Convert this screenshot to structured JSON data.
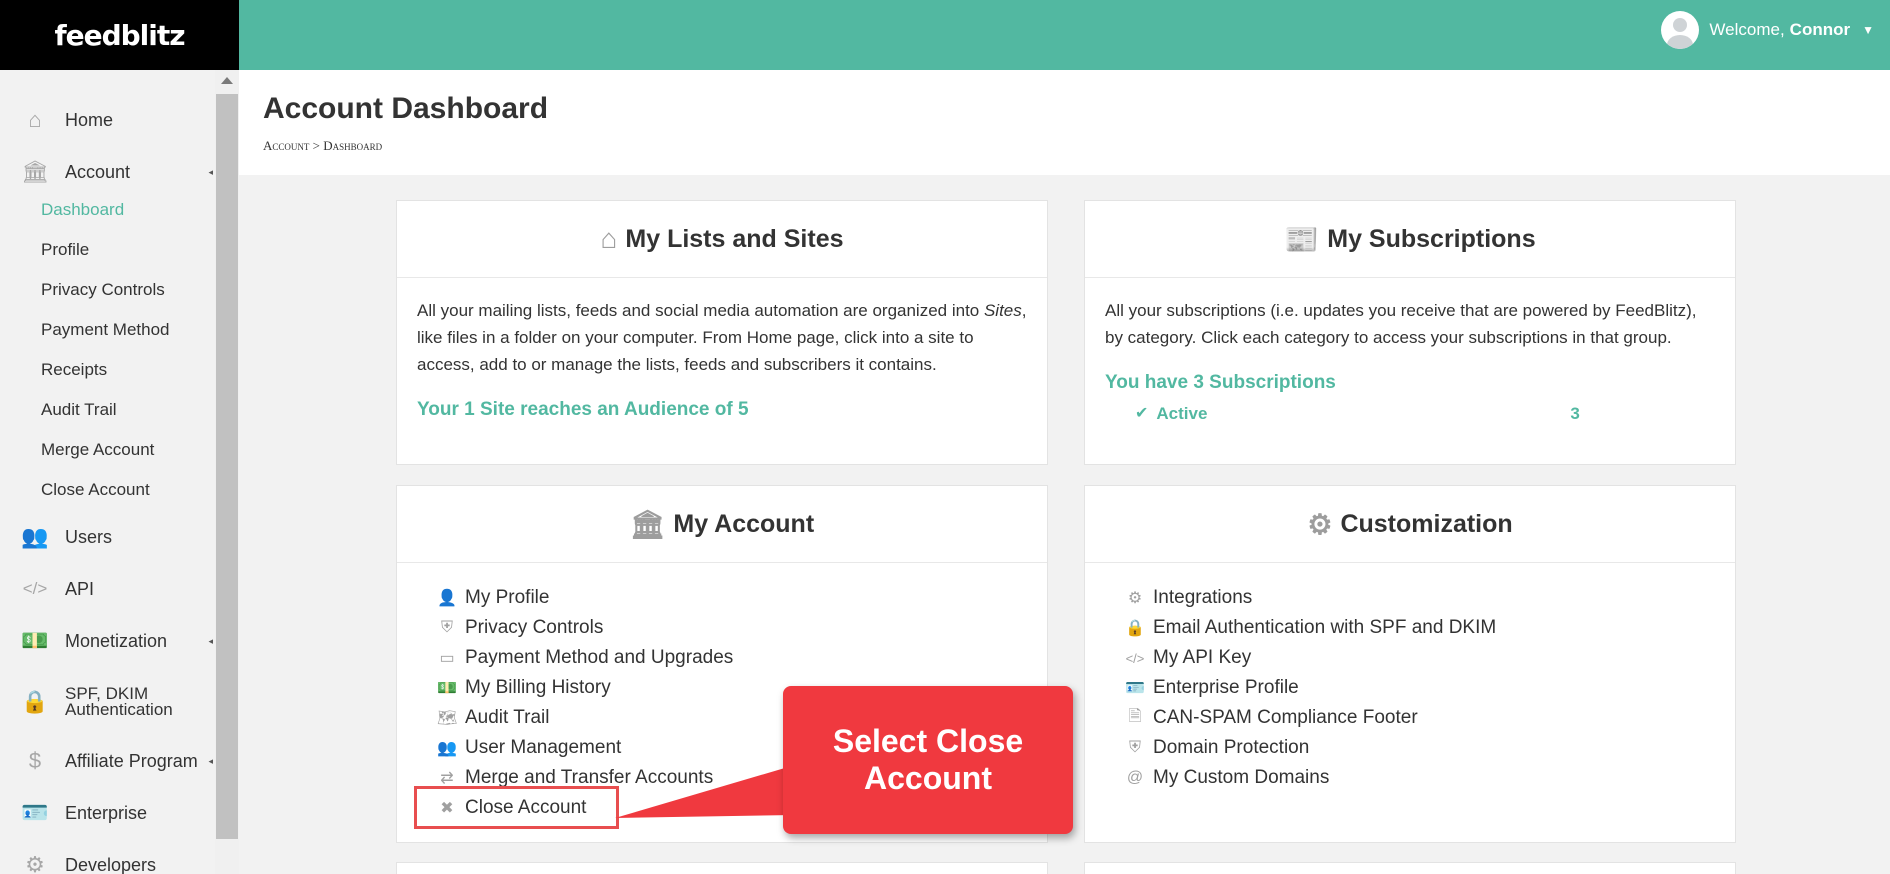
{
  "brand": {
    "logo": "feedblitz"
  },
  "user": {
    "welcome": "Welcome,",
    "name": "Connor"
  },
  "sidebar": {
    "home": "Home",
    "account": "Account",
    "sub": [
      "Dashboard",
      "Profile",
      "Privacy Controls",
      "Payment Method",
      "Receipts",
      "Audit Trail",
      "Merge Account",
      "Close Account"
    ],
    "users": "Users",
    "api": "API",
    "monetization": "Monetization",
    "spf_line1": "SPF, DKIM",
    "spf_line2": "Authentication",
    "affiliate": "Affiliate Program",
    "enterprise": "Enterprise",
    "developers": "Developers"
  },
  "page": {
    "title": "Account Dashboard",
    "breadcrumb": "Account > Dashboard"
  },
  "lists_card": {
    "title": "My Lists and Sites",
    "text_before": "All your mailing lists, feeds and social media automation are organized into ",
    "text_em": "Sites",
    "text_after": ", like files in a folder on your computer. From Home page, click into a site to access, add to or manage the lists, feeds and subscribers it contains.",
    "link": "Your 1 Site reaches an Audience of 5"
  },
  "subs_card": {
    "title": "My Subscriptions",
    "text": "All your subscriptions (i.e. updates you receive that are powered by FeedBlitz), by category. Click each category to access your subscriptions in that group.",
    "link": "You have 3 Subscriptions",
    "active_label": "Active",
    "active_count": "3"
  },
  "account_card": {
    "title": "My Account",
    "links": [
      "My Profile",
      "Privacy Controls",
      "Payment Method and Upgrades",
      "My Billing History",
      "Audit Trail",
      "User Management",
      "Merge and Transfer Accounts",
      "Close Account"
    ]
  },
  "custom_card": {
    "title": "Customization",
    "links": [
      "Integrations",
      "Email Authentication with SPF and DKIM",
      "My API Key",
      "Enterprise Profile",
      "CAN-SPAM Compliance Footer",
      "Domain Protection",
      "My Custom Domains"
    ]
  },
  "callout": {
    "text": "Select Close Account"
  }
}
